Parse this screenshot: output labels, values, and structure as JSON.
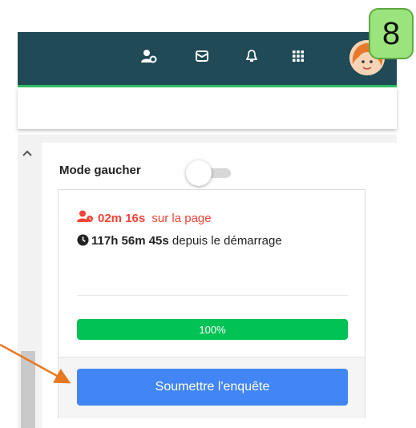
{
  "header": {
    "icons": [
      "user-settings-icon",
      "mail-icon",
      "bell-icon",
      "apps-grid-icon"
    ],
    "accent_color": "#1f4a56",
    "underline_color": "#2fbf63"
  },
  "annotation": {
    "step_number": "8"
  },
  "settings": {
    "left_hand_mode_label": "Mode gaucher",
    "left_hand_mode_on": false
  },
  "timer": {
    "page_time": "02m 16s",
    "page_time_suffix": " sur la page",
    "total_time": "117h 56m 45s",
    "total_time_suffix": " depuis le démarrage"
  },
  "progress": {
    "label": "100%",
    "value": 1.0,
    "color": "#00c255"
  },
  "actions": {
    "submit_label": "Soumettre l'enquête",
    "submit_color": "#4285f4"
  }
}
